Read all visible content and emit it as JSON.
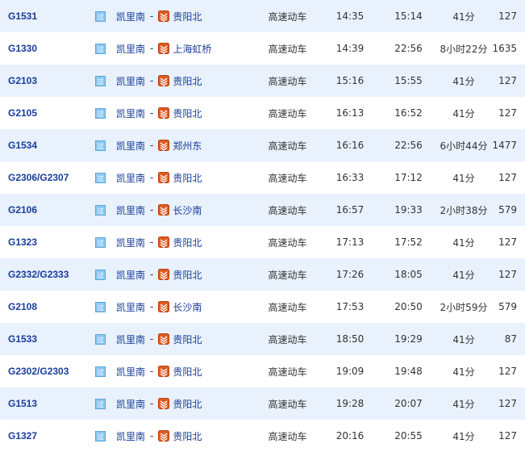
{
  "colors": {
    "row_alt": "#e8f1fc",
    "link": "#1a3d99",
    "end_icon": "#e05a20"
  },
  "icons": {
    "pass": "pass-icon",
    "end": "terminal-station-icon"
  },
  "pass_glyph": "过",
  "separator": "-",
  "rows": [
    {
      "no": "G1531",
      "from": "凯里南",
      "to": "贵阳北",
      "type": "高速动车",
      "dep": "14:35",
      "arr": "15:14",
      "duration": "41分",
      "distance": "127"
    },
    {
      "no": "G1330",
      "from": "凯里南",
      "to": "上海虹桥",
      "type": "高速动车",
      "dep": "14:39",
      "arr": "22:56",
      "duration": "8小时22分",
      "distance": "1635"
    },
    {
      "no": "G2103",
      "from": "凯里南",
      "to": "贵阳北",
      "type": "高速动车",
      "dep": "15:16",
      "arr": "15:55",
      "duration": "41分",
      "distance": "127"
    },
    {
      "no": "G2105",
      "from": "凯里南",
      "to": "贵阳北",
      "type": "高速动车",
      "dep": "16:13",
      "arr": "16:52",
      "duration": "41分",
      "distance": "127"
    },
    {
      "no": "G1534",
      "from": "凯里南",
      "to": "郑州东",
      "type": "高速动车",
      "dep": "16:16",
      "arr": "22:56",
      "duration": "6小时44分",
      "distance": "1477"
    },
    {
      "no": "G2306/G2307",
      "from": "凯里南",
      "to": "贵阳北",
      "type": "高速动车",
      "dep": "16:33",
      "arr": "17:12",
      "duration": "41分",
      "distance": "127"
    },
    {
      "no": "G2106",
      "from": "凯里南",
      "to": "长沙南",
      "type": "高速动车",
      "dep": "16:57",
      "arr": "19:33",
      "duration": "2小时38分",
      "distance": "579"
    },
    {
      "no": "G1323",
      "from": "凯里南",
      "to": "贵阳北",
      "type": "高速动车",
      "dep": "17:13",
      "arr": "17:52",
      "duration": "41分",
      "distance": "127"
    },
    {
      "no": "G2332/G2333",
      "from": "凯里南",
      "to": "贵阳北",
      "type": "高速动车",
      "dep": "17:26",
      "arr": "18:05",
      "duration": "41分",
      "distance": "127"
    },
    {
      "no": "G2108",
      "from": "凯里南",
      "to": "长沙南",
      "type": "高速动车",
      "dep": "17:53",
      "arr": "20:50",
      "duration": "2小时59分",
      "distance": "579"
    },
    {
      "no": "G1533",
      "from": "凯里南",
      "to": "贵阳北",
      "type": "高速动车",
      "dep": "18:50",
      "arr": "19:29",
      "duration": "41分",
      "distance": "87"
    },
    {
      "no": "G2302/G2303",
      "from": "凯里南",
      "to": "贵阳北",
      "type": "高速动车",
      "dep": "19:09",
      "arr": "19:48",
      "duration": "41分",
      "distance": "127"
    },
    {
      "no": "G1513",
      "from": "凯里南",
      "to": "贵阳北",
      "type": "高速动车",
      "dep": "19:28",
      "arr": "20:07",
      "duration": "41分",
      "distance": "127"
    },
    {
      "no": "G1327",
      "from": "凯里南",
      "to": "贵阳北",
      "type": "高速动车",
      "dep": "20:16",
      "arr": "20:55",
      "duration": "41分",
      "distance": "127"
    }
  ]
}
